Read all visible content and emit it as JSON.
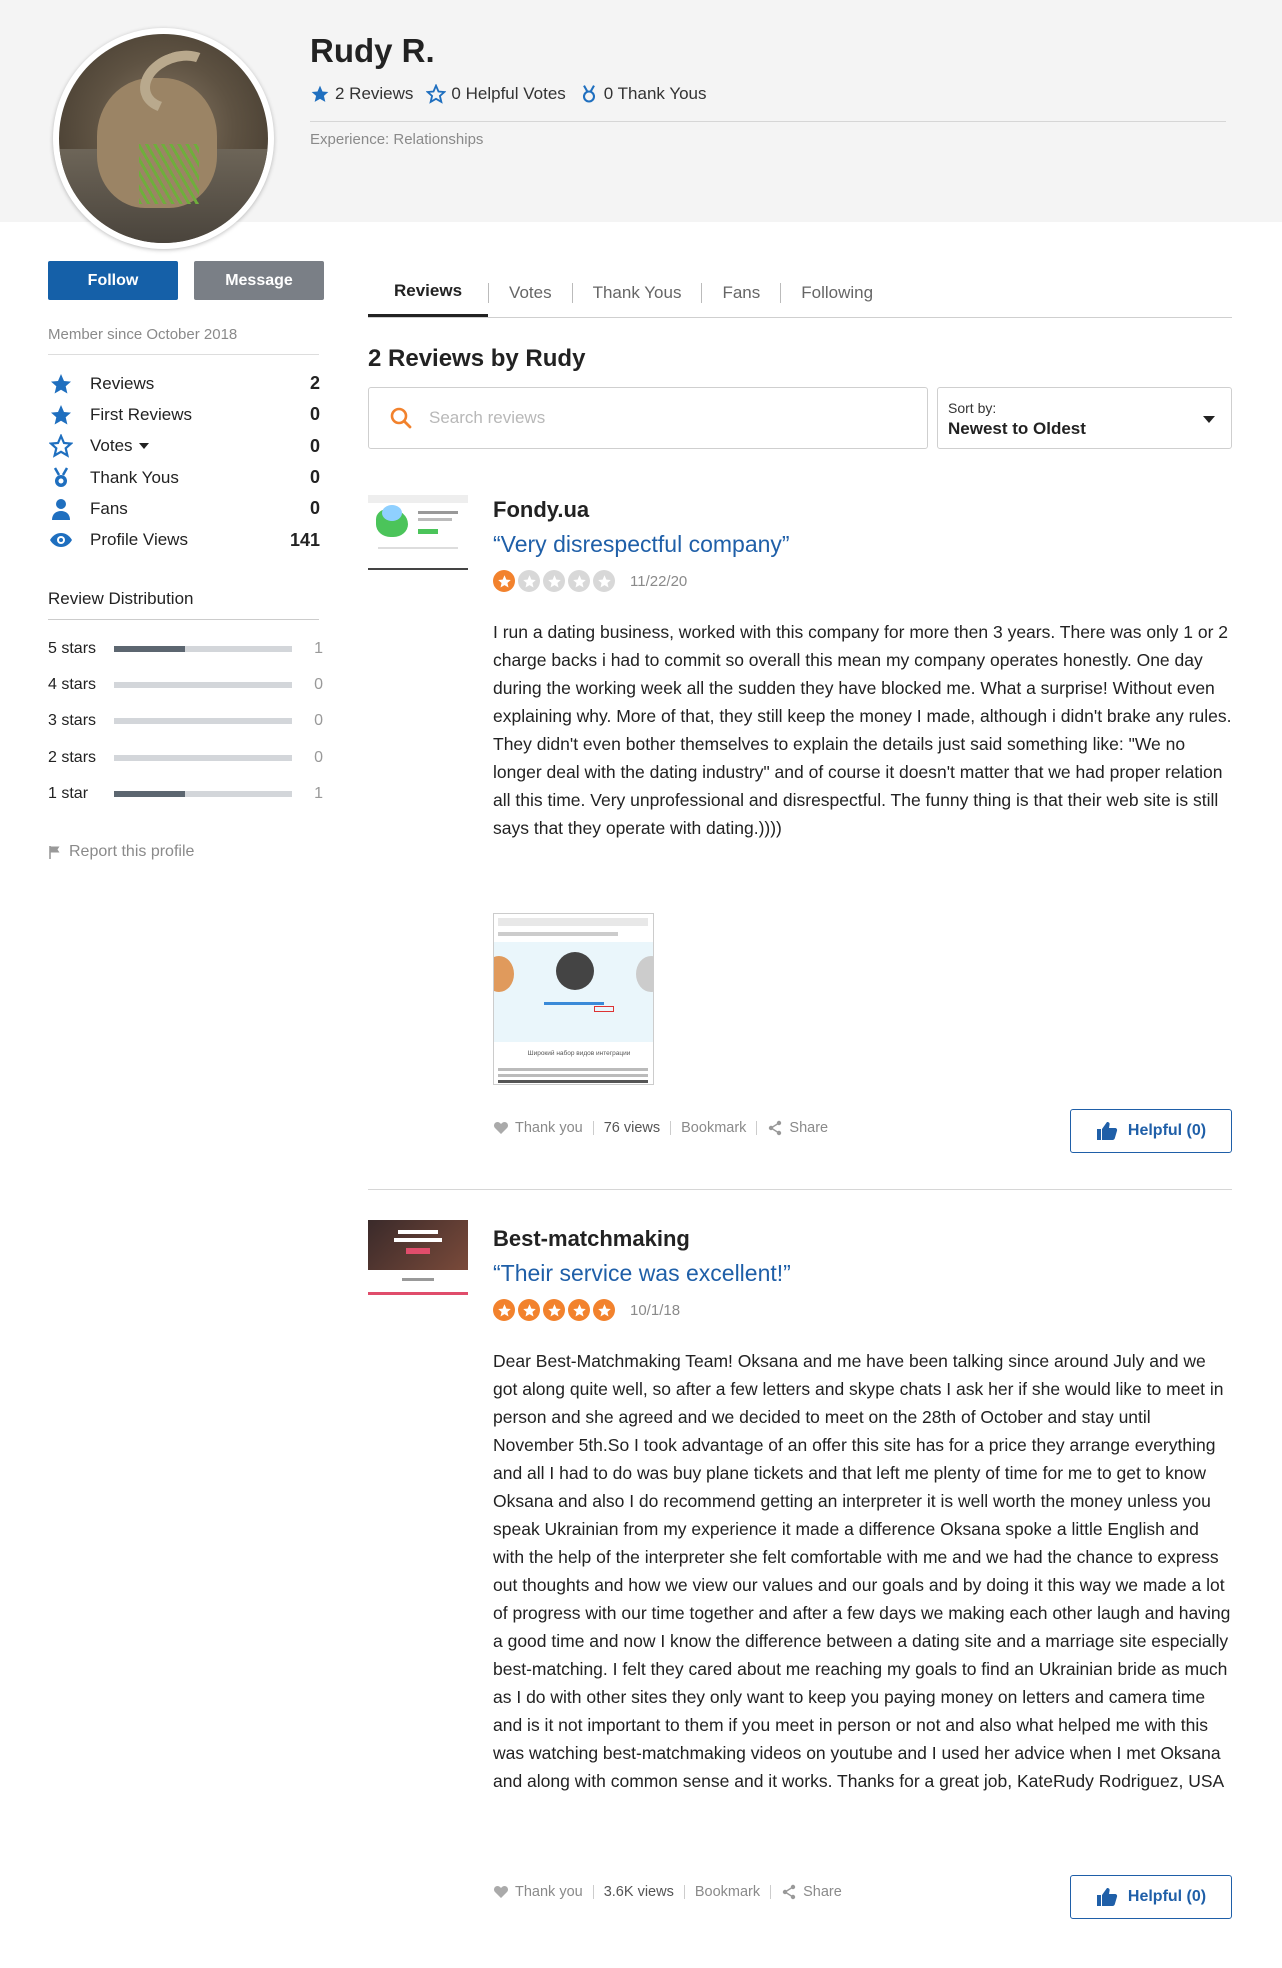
{
  "profile": {
    "name": "Rudy R.",
    "reviews_stat": "2 Reviews",
    "helpful_stat": "0 Helpful Votes",
    "thanks_stat": "0 Thank Yous",
    "experience": "Experience: Relationships"
  },
  "sidebar": {
    "follow_label": "Follow",
    "message_label": "Message",
    "member_since": "Member since October 2018",
    "stats": [
      {
        "label": "Reviews",
        "value": "2",
        "icon": "star-icon"
      },
      {
        "label": "First Reviews",
        "value": "0",
        "icon": "star-icon"
      },
      {
        "label": "Votes",
        "value": "0",
        "icon": "star-outline-icon"
      },
      {
        "label": "Thank Yous",
        "value": "0",
        "icon": "medal-icon"
      },
      {
        "label": "Fans",
        "value": "0",
        "icon": "person-icon"
      },
      {
        "label": "Profile Views",
        "value": "141",
        "icon": "eye-icon"
      }
    ],
    "distribution_title": "Review Distribution",
    "distribution": [
      {
        "label": "5 stars",
        "count": "1",
        "fraction": 0.4
      },
      {
        "label": "4 stars",
        "count": "0",
        "fraction": 0
      },
      {
        "label": "3 stars",
        "count": "0",
        "fraction": 0
      },
      {
        "label": "2 stars",
        "count": "0",
        "fraction": 0
      },
      {
        "label": "1 star",
        "count": "1",
        "fraction": 0.4
      }
    ],
    "report_label": "Report this profile"
  },
  "tabs": [
    {
      "label": "Reviews",
      "active": true
    },
    {
      "label": "Votes",
      "active": false
    },
    {
      "label": "Thank Yous",
      "active": false
    },
    {
      "label": "Fans",
      "active": false
    },
    {
      "label": "Following",
      "active": false
    }
  ],
  "reviews_section": {
    "title": "2 Reviews by Rudy",
    "search_placeholder": "Search reviews",
    "sort_label": "Sort by:",
    "sort_value": "Newest to Oldest"
  },
  "reviews": [
    {
      "business": "Fondy.ua",
      "title": "“Very disrespectful company”",
      "rating": 1,
      "date": "11/22/20",
      "body": "I run a dating business, worked with this company for more then 3 years. There was only 1 or 2 charge backs i had to commit so overall this mean my company operates honestly. One day during the working week all the sudden they have blocked me. What a surprise! Without even explaining why. More of that, they still keep the money I made, although i didn't brake any rules. They didn't even bother themselves to explain the details just said something like: \"We no longer deal with the dating industry\" and of course it doesn't matter that we had proper relation all this time. Very unprofessional and disrespectful. The funny thing is that their web site is still says that they operate with dating.))))",
      "thank_label": "Thank you",
      "views": "76 views",
      "bookmark_label": "Bookmark",
      "share_label": "Share",
      "helpful_label": "Helpful (0)",
      "attachment_caption": "Широкий набор видов интеграции"
    },
    {
      "business": "Best-matchmaking",
      "title": "“Their service was excellent!”",
      "rating": 5,
      "date": "10/1/18",
      "body": "Dear Best-Matchmaking Team! Oksana and me have been talking since around July and we got along quite well, so after a few letters and skype chats I ask her if she would like to meet in person and she agreed and we decided to meet on the 28th of October and stay until November 5th.So I took advantage of an offer this site has for a price they arrange everything and all I had to do was buy plane tickets and that left me plenty of time for me to get to know Oksana and also I do recommend getting an interpreter it is well worth the money unless you speak Ukrainian from my experience it made a difference Oksana spoke a little English and with the help of the interpreter she felt comfortable with me and we had the chance to express out thoughts and how we view our values and our goals and by doing it this way we made a lot of progress with our time together and after a few days we making each other laugh and having a good time and now I know the difference between a dating site and a marriage site especially best-matching. I felt they cared about me reaching my goals to find an Ukrainian bride as much as I do with other sites they only want to keep you paying money on letters and camera time and is it not important to them if you meet in person or not and also what helped me with this was watching best-matchmaking videos on youtube and I used her advice when I met Oksana and along with common sense and it works. Thanks for a great job, KateRudy Rodriguez, USA",
      "thank_label": "Thank you",
      "views": "3.6K views",
      "bookmark_label": "Bookmark",
      "share_label": "Share",
      "helpful_label": "Helpful (0)"
    }
  ],
  "colors": {
    "brand_blue": "#1560a8",
    "link_blue": "#1f5fa8",
    "star_orange": "#f2822d",
    "grey_button": "#7a7f86"
  }
}
